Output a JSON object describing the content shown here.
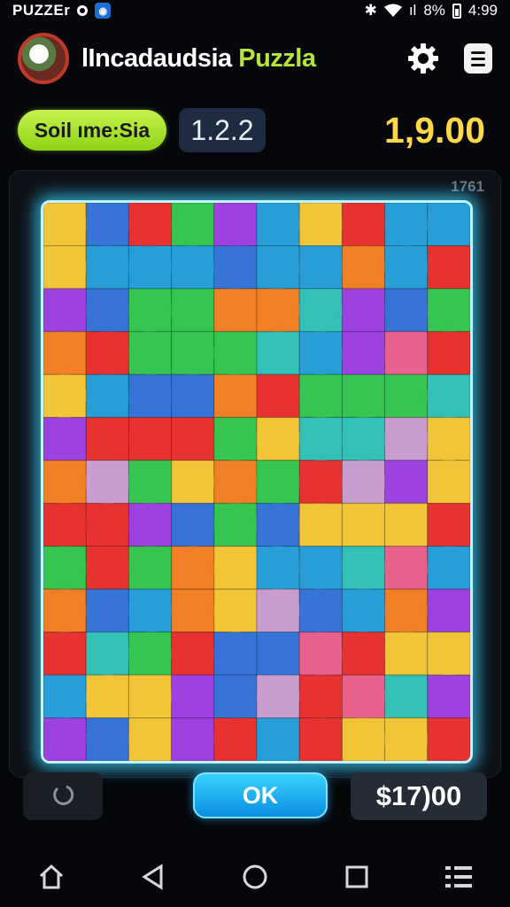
{
  "status_bar": {
    "app_label": "PUZZEr",
    "battery": "8%",
    "time": "4:99"
  },
  "header": {
    "title_main": "lIncadaudsia",
    "title_accent": "Puzzla",
    "icons": {
      "logo": "app-logo",
      "settings": "gear-icon",
      "menu": "hamburger-menu-icon"
    }
  },
  "stats": {
    "mode_label": "Soil ıme:Sia",
    "level": "1.2.2",
    "score": "1,9.00"
  },
  "board": {
    "counter": "1761",
    "glow_color": "#3ad1ff",
    "piece_colors": [
      "#e82a2a",
      "#1f9bd6",
      "#2f6fd6",
      "#2ec34a",
      "#f2c230",
      "#9b3ae0",
      "#f07a1e",
      "#e85a88",
      "#2bbfb5",
      "#ffffff",
      "#0b1a45",
      "#c89ad0"
    ]
  },
  "actions": {
    "undo_icon": "undo-icon",
    "ok_label": "OK",
    "coins": "$17)00"
  },
  "nav": {
    "items": [
      "home-icon",
      "back-icon",
      "circle-home-icon",
      "recents-icon",
      "list-icon"
    ]
  }
}
